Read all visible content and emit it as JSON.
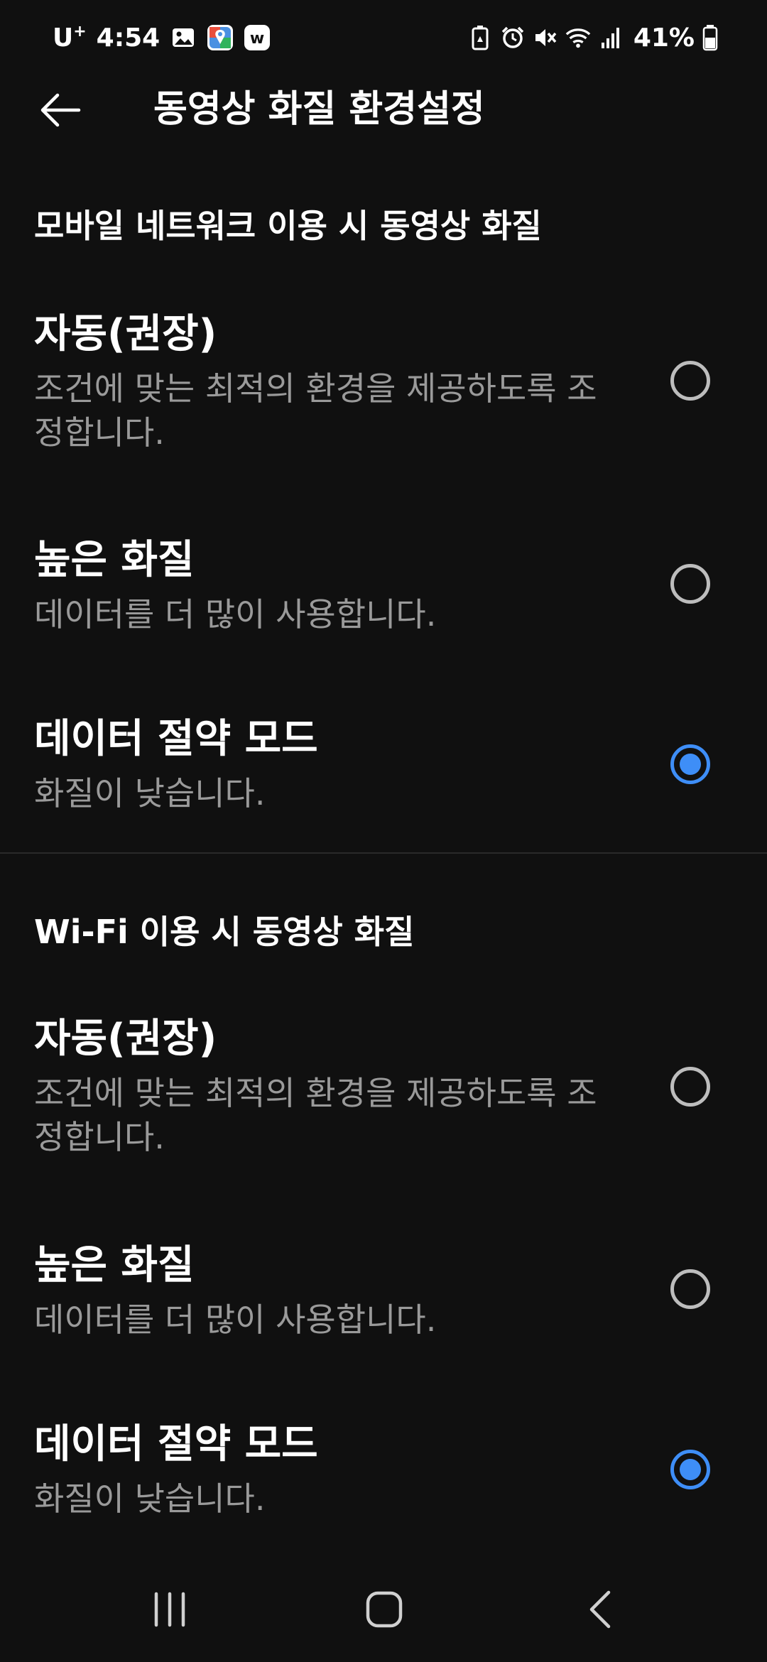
{
  "status_bar": {
    "carrier": "U",
    "carrier_sup": "+",
    "time": "4:54",
    "notification_icons": [
      "gallery-icon",
      "maps-app-icon",
      "w-app-icon"
    ],
    "system_icons": [
      "battery-saver-icon",
      "alarm-icon",
      "mute-icon",
      "wifi-icon",
      "signal-icon"
    ],
    "battery_percent": "41%"
  },
  "header": {
    "title": "동영상 화질 환경설정"
  },
  "sections": [
    {
      "title": "모바일 네트워크 이용 시 동영상 화질",
      "options": [
        {
          "title": "자동(권장)",
          "desc": "조건에 맞는 최적의 환경을 제공하도록 조정합니다.",
          "selected": false
        },
        {
          "title": "높은 화질",
          "desc": "데이터를 더 많이 사용합니다.",
          "selected": false
        },
        {
          "title": "데이터 절약 모드",
          "desc": "화질이 낮습니다.",
          "selected": true
        }
      ]
    },
    {
      "title": "Wi-Fi 이용 시 동영상 화질",
      "options": [
        {
          "title": "자동(권장)",
          "desc": "조건에 맞는 최적의 환경을 제공하도록 조정합니다.",
          "selected": false
        },
        {
          "title": "높은 화질",
          "desc": "데이터를 더 많이 사용합니다.",
          "selected": false
        },
        {
          "title": "데이터 절약 모드",
          "desc": "화질이 낮습니다.",
          "selected": true
        }
      ]
    }
  ],
  "colors": {
    "background": "#101010",
    "accent": "#3e8ef7",
    "secondary_text": "#9a9a9a"
  },
  "nav_bar": {
    "buttons": [
      "recent-apps-icon",
      "home-icon",
      "back-nav-icon"
    ]
  }
}
